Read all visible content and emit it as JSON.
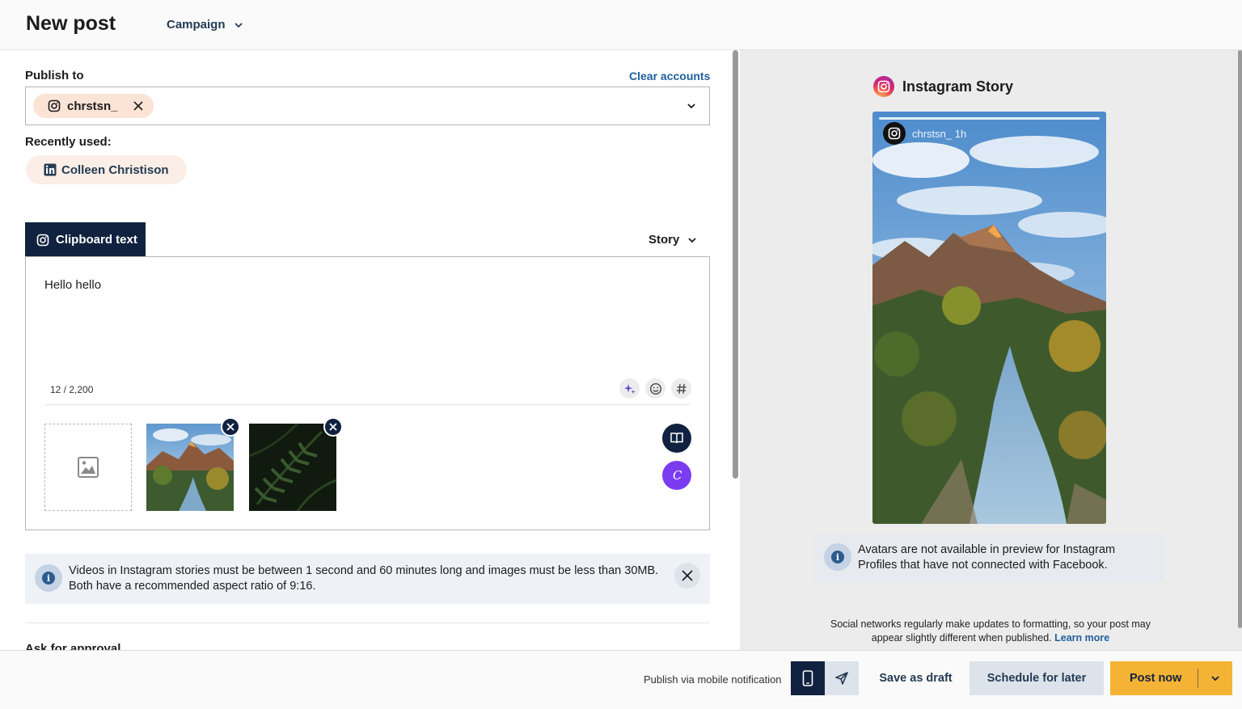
{
  "header": {
    "title": "New post",
    "campaign_label": "Campaign"
  },
  "publish": {
    "label": "Publish to",
    "clear_label": "Clear accounts",
    "selected_account": "chrstsn_",
    "recently_used_label": "Recently used:",
    "recent_account": "Colleen Christison"
  },
  "composer": {
    "tab_label": "Clipboard text",
    "post_type": "Story",
    "text": "Hello hello",
    "char_count": "12 / 2,200"
  },
  "notice": {
    "text": "Videos in Instagram stories must be between 1 second and 60 minutes long and images must be less than 30MB. Both have a recommended aspect ratio of 9:16."
  },
  "approval": {
    "label": "Ask for approval"
  },
  "preview": {
    "title": "Instagram Story",
    "story_user": "chrstsn_ 1h",
    "avatar_note": "Avatars are not available in preview for Instagram Profiles that have not connected with Facebook.",
    "disclaimer": "Social networks regularly make updates to formatting, so your post may appear slightly different when published.",
    "learn_more": "Learn more"
  },
  "footer": {
    "mobile_text": "Publish via mobile notification",
    "save_draft": "Save as draft",
    "schedule": "Schedule for later",
    "post_now": "Post now"
  },
  "colors": {
    "navy": "#112240",
    "accent_link": "#1f5f9c",
    "post_button": "#f5b335",
    "chip_bg": "#fbe3d6"
  },
  "icons": [
    "chevron-down-icon",
    "instagram-icon",
    "close-icon",
    "linkedin-icon",
    "ai-sparkle-icon",
    "emoji-icon",
    "hashtag-icon",
    "image-icon",
    "book-icon",
    "canva-icon",
    "info-icon",
    "mobile-icon",
    "send-icon"
  ]
}
